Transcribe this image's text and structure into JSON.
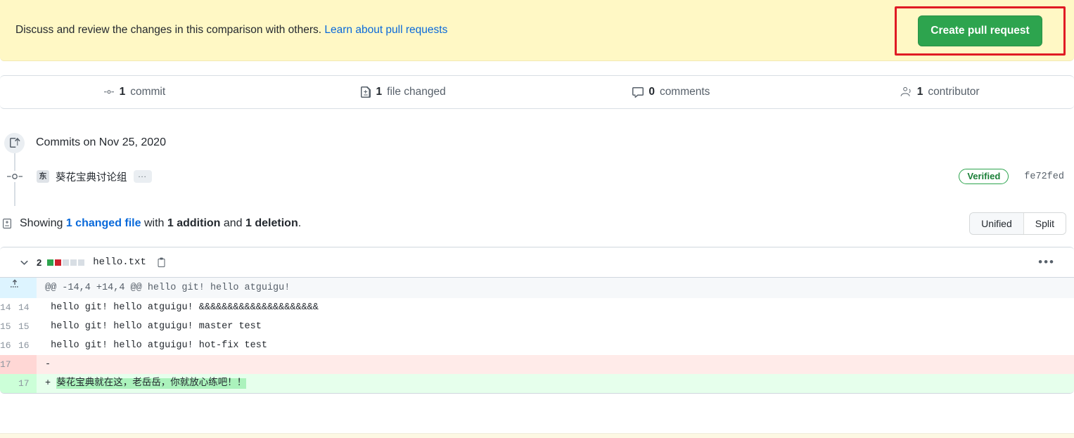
{
  "notice": {
    "text": "Discuss and review the changes in this comparison with others.",
    "link_text": "Learn about pull requests",
    "button_label": "Create pull request",
    "button_color": "#2da44e",
    "background_color": "#fff8c5",
    "highlight_color": "#e01b24"
  },
  "stats": [
    {
      "icon": "commit-icon",
      "value": "1",
      "label": "commit"
    },
    {
      "icon": "file-diff-icon",
      "value": "1",
      "label": "file changed"
    },
    {
      "icon": "comment-icon",
      "value": "0",
      "label": "comments"
    },
    {
      "icon": "people-icon",
      "value": "1",
      "label": "contributor"
    }
  ],
  "commits": {
    "group_title": "Commits on Nov 25, 2020",
    "timeline_icon": "repo-push-icon",
    "commit_icon": "commit-dot-icon",
    "author_avatar_initial": "东",
    "author": "葵花宝典讨论组",
    "more_label": "...",
    "verified_label": "Verified",
    "sha": "fe72fed"
  },
  "showing": {
    "icon": "file-diff-icon",
    "prefix": "Showing ",
    "changed_file_link": "1 changed file",
    "middle": " with ",
    "additions": "1 addition",
    "conjunction": " and ",
    "deletions": "1 deletion",
    "suffix": ".",
    "view_unified": "Unified",
    "view_split": "Split",
    "selected_view": "Unified"
  },
  "file": {
    "changes_count": "2",
    "diffstat": [
      "add",
      "del",
      "neutral",
      "neutral",
      "neutral"
    ],
    "name": "hello.txt",
    "copy_icon": "copy-icon",
    "collapse_icon": "chevron-down-icon",
    "menu_icon": "kebab-horizontal-icon",
    "hunk_header": "@@ -14,4 +14,4 @@ hello git! hello atguigu!",
    "expand_icon": "unfold-icon",
    "lines": [
      {
        "type": "ctx",
        "old": "14",
        "new": "14",
        "marker": " ",
        "text": "hello git! hello atguigu! &&&&&&&&&&&&&&&&&&&&&"
      },
      {
        "type": "ctx",
        "old": "15",
        "new": "15",
        "marker": " ",
        "text": "hello git! hello atguigu! master test"
      },
      {
        "type": "ctx",
        "old": "16",
        "new": "16",
        "marker": " ",
        "text": "hello git! hello atguigu! hot-fix test"
      },
      {
        "type": "del",
        "old": "17",
        "new": "",
        "marker": "-",
        "text": ""
      },
      {
        "type": "add",
        "old": "",
        "new": "17",
        "marker": "+",
        "text": "葵花宝典就在这，老岳岳，你就放心练吧！！",
        "word_highlight": true
      }
    ]
  }
}
